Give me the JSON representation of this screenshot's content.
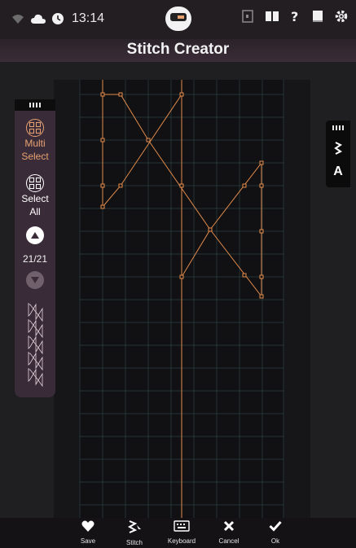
{
  "status_bar": {
    "time": "13:14",
    "icons": [
      "wifi-icon",
      "cloud-icon",
      "clock-icon",
      "exit-icon",
      "book-icon",
      "help-icon",
      "manual-icon",
      "gear-icon"
    ]
  },
  "header": {
    "title": "Stitch Creator"
  },
  "left_toolbar": {
    "multi_select": {
      "line1": "Multi",
      "line2": "Select",
      "icon": "multi-select-icon"
    },
    "select_all": {
      "line1": "Select",
      "line2": "All",
      "icon": "select-all-icon"
    },
    "up_icon": "arrow-up-icon",
    "down_icon": "arrow-down-icon",
    "counter": "21/21"
  },
  "right_toolbar": {
    "stitch_icon": "zigzag-icon",
    "text_label": "A"
  },
  "bottom_bar": {
    "actions": [
      {
        "label": "Save",
        "icon": "heart-icon"
      },
      {
        "label": "Stitch",
        "icon": "stitch-icon"
      },
      {
        "label": "Keyboard",
        "icon": "keyboard-icon"
      },
      {
        "label": "Cancel",
        "icon": "close-icon"
      },
      {
        "label": "Ok",
        "icon": "check-icon"
      }
    ]
  },
  "colors": {
    "accent": "#e8a271",
    "stitch_line": "#e28b4b",
    "panel": "#3a2b38",
    "background": "#1f1f22"
  }
}
